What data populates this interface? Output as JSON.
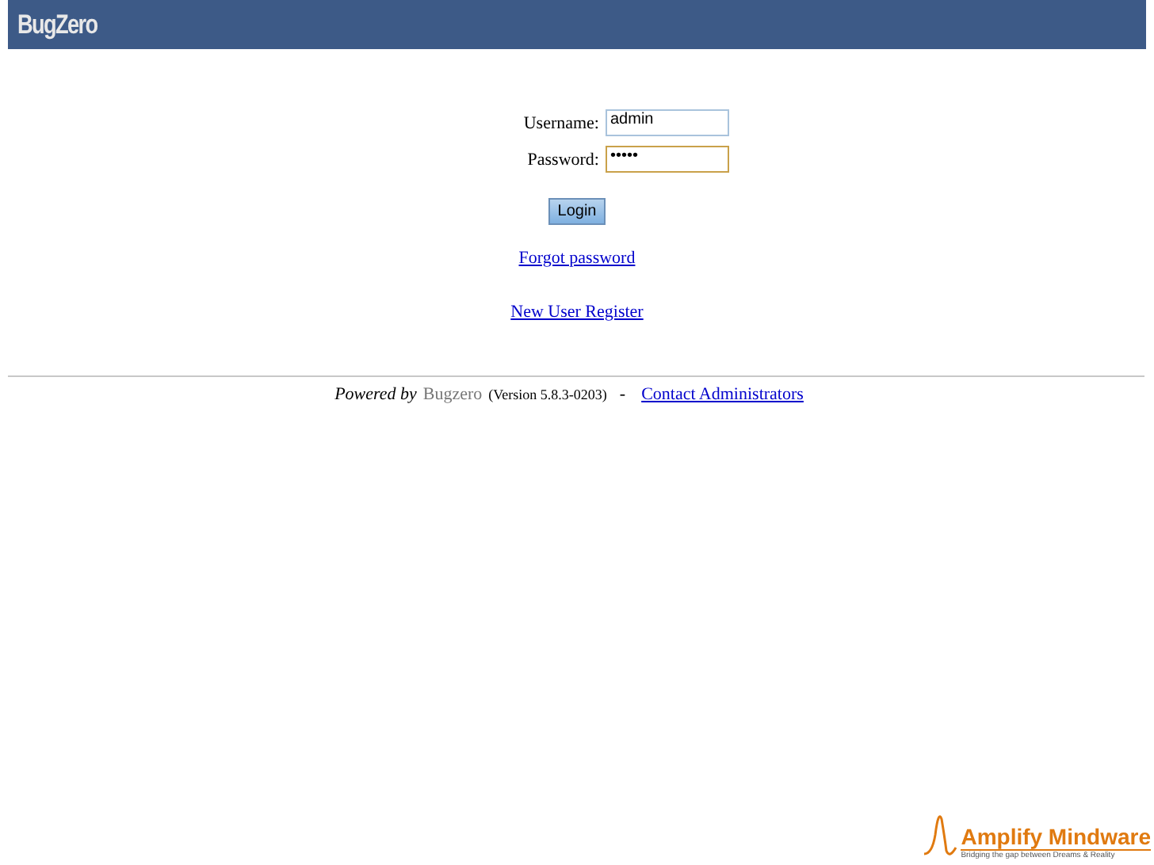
{
  "header": {
    "logo": "BugZero"
  },
  "login_form": {
    "fields": [
      {
        "label": "Username:",
        "value": "admin",
        "focused": false
      },
      {
        "label": "Password:",
        "value": "•••••",
        "focused": true
      }
    ],
    "login_button": "Login",
    "forgot_link": "Forgot password",
    "register_link": "New User Register"
  },
  "footer": {
    "powered_by": "Powered by",
    "product": "Bugzero",
    "version": "(Version 5.8.3-0203)",
    "separator": "-",
    "contact_link": "Contact Administrators"
  },
  "corner_logo": {
    "name": "Amplify Mindware",
    "tagline": "Bridging the gap between Dreams & Reality"
  }
}
